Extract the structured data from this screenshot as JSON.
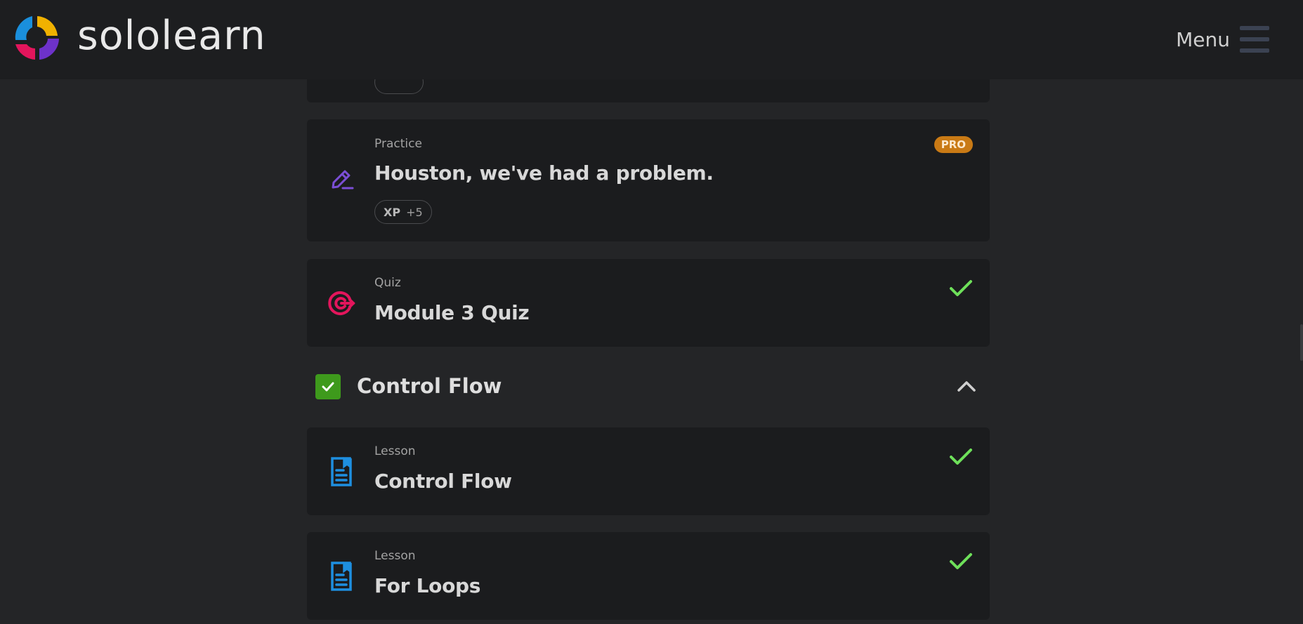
{
  "header": {
    "brand": "sololearn",
    "menu_label": "Menu"
  },
  "cards": [
    {
      "type": "",
      "title": "",
      "partial": true
    },
    {
      "type": "Practice",
      "title": "Houston, we've had a problem.",
      "badge": "PRO",
      "xp_label": "XP",
      "xp_value": "+5",
      "icon": "practice-edit-icon",
      "icon_color": "#7b4ed6"
    },
    {
      "type": "Quiz",
      "title": "Module 3 Quiz",
      "completed": true,
      "icon": "target-quiz-icon",
      "icon_color": "#e3155c"
    }
  ],
  "section": {
    "title": "Control Flow",
    "completed": true,
    "expanded": true
  },
  "lessons": [
    {
      "type": "Lesson",
      "title": "Control Flow",
      "completed": true,
      "icon": "lesson-doc-icon"
    },
    {
      "type": "Lesson",
      "title": "For Loops",
      "completed": true,
      "icon": "lesson-doc-icon"
    }
  ],
  "colors": {
    "background": "#242527",
    "card": "#1b1c1e",
    "pro_badge": "#c97a15",
    "check_green": "#6ee05a",
    "section_check": "#3e9a1c",
    "lesson_icon": "#1e8fe0"
  }
}
